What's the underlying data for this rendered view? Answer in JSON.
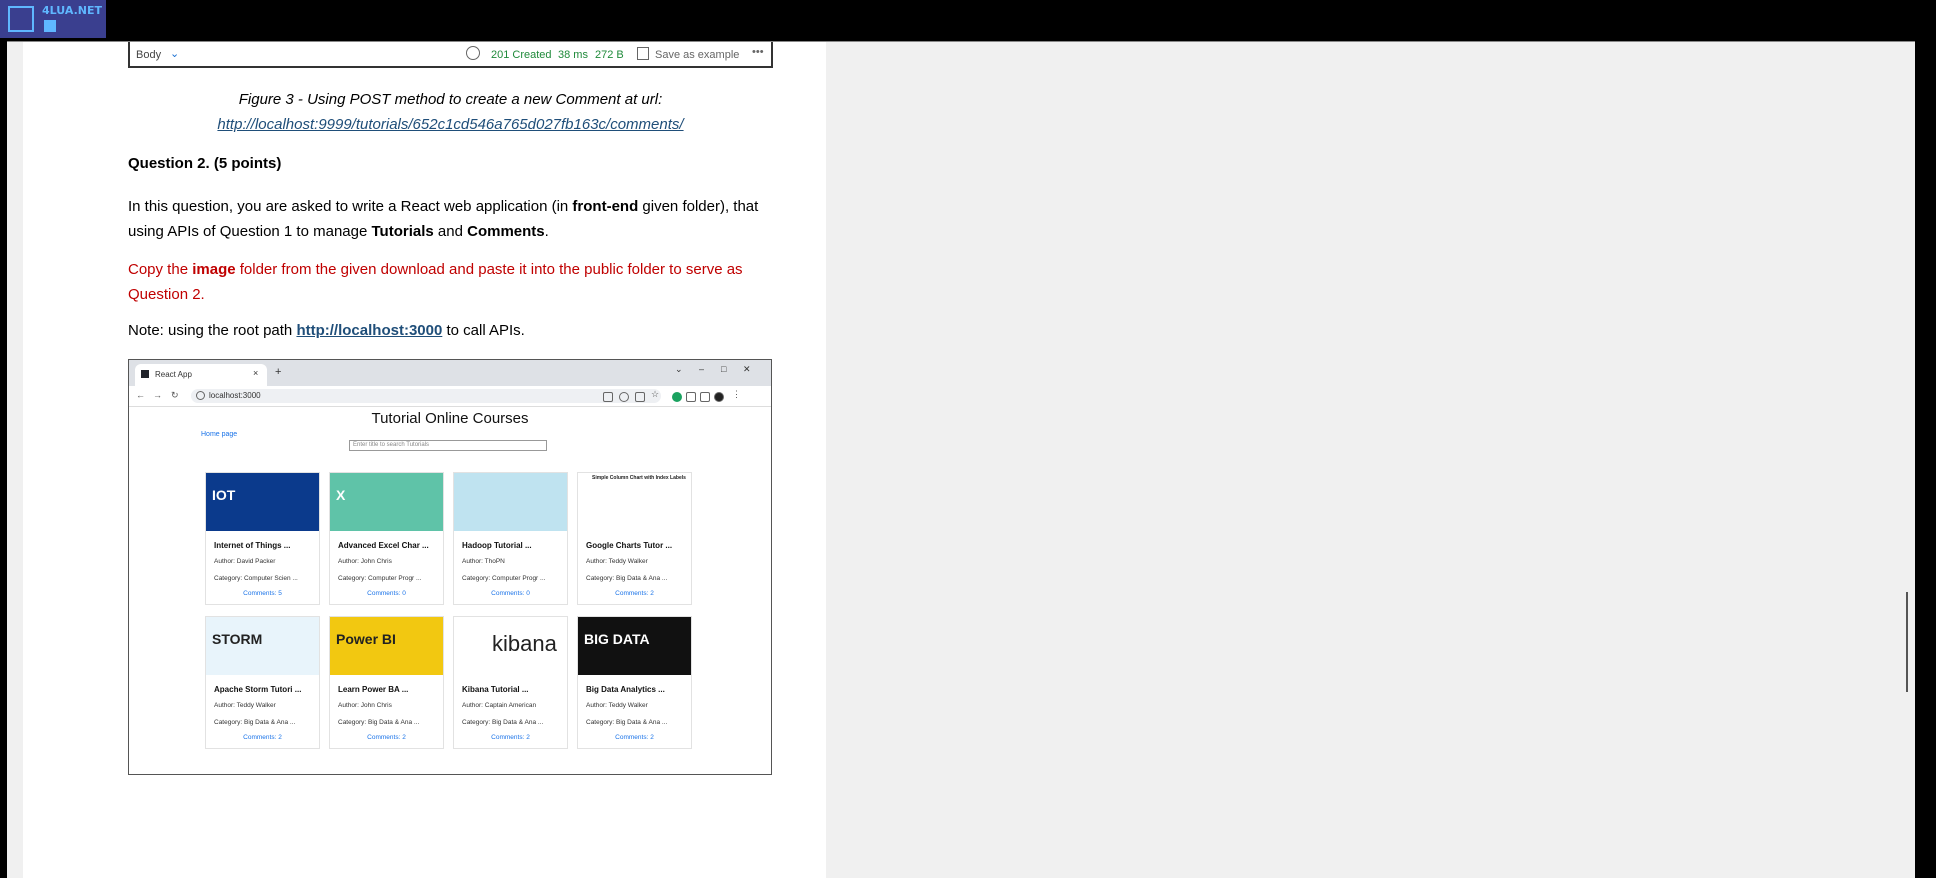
{
  "watermark": {
    "text": "4LUA.NET"
  },
  "snippet": {
    "body_label": "Body",
    "status": "201 Created",
    "time": "38 ms",
    "size": "272 B",
    "save_label": "Save as example",
    "more": "•••"
  },
  "doc": {
    "caption": "Figure 3 - Using POST method to create a new Comment at url:",
    "caption_link": "http://localhost:9999/tutorials/652c1cd546a765d027fb163c/comments/",
    "question_title": "Question 2. (5 points)",
    "para1_a": "In this question, you are asked to write a React web application (in ",
    "para1_b": "front-end",
    "para1_c": " given folder), that",
    "para1_d": "using APIs of Question 1 to manage ",
    "para1_e": "Tutorials",
    "para1_f": " and ",
    "para1_g": "Comments",
    "para1_h": ".",
    "red_a": "Copy the ",
    "red_b": "image",
    "red_c": " folder from the given download and paste it into the public folder to serve as",
    "red_d": "Question 2.",
    "note_a": "Note: using the root path ",
    "note_link": "http://localhost:3000",
    "note_b": " to call APIs."
  },
  "browser": {
    "tab_title": "React App",
    "tab_close": "×",
    "new_tab": "+",
    "address": "localhost:3000",
    "app_title": "Tutorial Online Courses",
    "home_link": "Home page",
    "search_placeholder": "Enter title to search Tutorials",
    "cards": [
      {
        "title": "Internet of Things ...",
        "author": "Author: David Packer",
        "category": "Category: Computer Scien ...",
        "comments": "Comments: 5",
        "img_text": "IOT",
        "img_bg": "#0b3a8c"
      },
      {
        "title": "Advanced Excel Char ...",
        "author": "Author: John Chris",
        "category": "Category: Computer Progr ...",
        "comments": "Comments: 0",
        "img_text": "X",
        "img_bg": "#5fc3a8"
      },
      {
        "title": "Hadoop Tutorial ...",
        "author": "Author: ThoPN",
        "category": "Category: Computer Progr ...",
        "comments": "Comments: 0",
        "img_text": "",
        "img_bg": "#bfe3f0"
      },
      {
        "title": "Google Charts Tutor ...",
        "author": "Author: Teddy Walker",
        "category": "Category: Big Data & Ana ...",
        "comments": "Comments: 2",
        "img_text": "Simple Column Chart with Index Labels",
        "img_bg": "#ffffff"
      },
      {
        "title": "Apache Storm Tutori ...",
        "author": "Author: Teddy Walker",
        "category": "Category: Big Data & Ana ...",
        "comments": "Comments: 2",
        "img_text": "STORM",
        "img_bg": "#e8f4fb"
      },
      {
        "title": "Learn Power BA ...",
        "author": "Author: John Chris",
        "category": "Category: Big Data & Ana ...",
        "comments": "Comments: 2",
        "img_text": "Power BI",
        "img_bg": "#f2c811"
      },
      {
        "title": "Kibana Tutorial ...",
        "author": "Author: Captain American",
        "category": "Category: Big Data & Ana ...",
        "comments": "Comments: 2",
        "img_text": "kibana",
        "img_bg": "#ffffff"
      },
      {
        "title": "Big Data Analytics ...",
        "author": "Author: Teddy Walker",
        "category": "Category: Big Data & Ana ...",
        "comments": "Comments: 2",
        "img_text": "BIG DATA",
        "img_bg": "#111111"
      }
    ]
  }
}
